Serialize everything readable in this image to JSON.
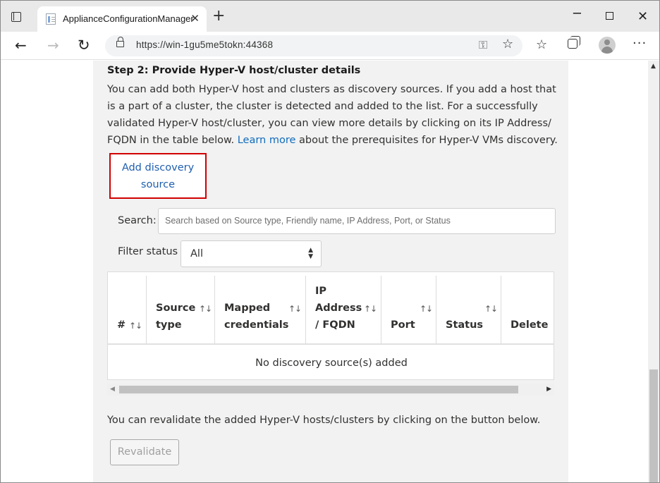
{
  "browser": {
    "tab_title": "ApplianceConfigurationManager",
    "url": "https://win-1gu5me5tokn:44368"
  },
  "step": {
    "title": "Step 2: Provide Hyper-V host/cluster details",
    "desc_part1": "You can add both Hyper-V host and clusters as discovery sources. If you add a host that is a part of a cluster, the cluster is detected and added to the list. For a successfully validated Hyper-V host/cluster, you can view more details by clicking on its IP Address/ FQDN in the table below. ",
    "learn_more": "Learn more",
    "desc_part2": " about the prerequisites for Hyper-V VMs discovery."
  },
  "add_source": {
    "label": "Add discovery source"
  },
  "search": {
    "label": "Search:",
    "placeholder": "Search based on Source type, Friendly name, IP Address, Port, or Status"
  },
  "filter": {
    "label": "Filter status",
    "selected": "All"
  },
  "table": {
    "columns": [
      "#",
      "Source type",
      "Mapped credentials",
      "IP Address / FQDN",
      "Port",
      "Status",
      "Delete"
    ],
    "empty_message": "No discovery source(s) added"
  },
  "revalidate": {
    "text": "You can revalidate the added Hyper-V hosts/clusters by clicking on the button below.",
    "button": "Revalidate"
  },
  "icons": {
    "sort": "sort-arrows-icon",
    "select": "select-arrows-icon"
  }
}
